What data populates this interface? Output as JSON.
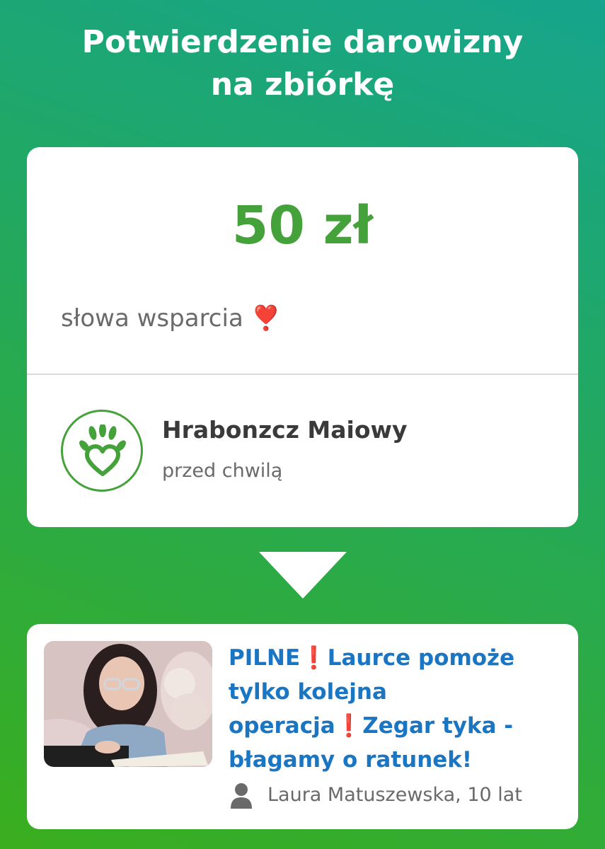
{
  "page": {
    "title_line1": "Potwierdzenie darowizny",
    "title_line2": "na zbiórkę"
  },
  "donation": {
    "amount": "50 zł",
    "message": "słowa wsparcia",
    "message_emoji": "❣️",
    "donor_name": "Hrabonzcz Maiowy",
    "time": "przed chwilą",
    "avatar_icon": "hand-heart-icon",
    "accent_color": "#45a23a"
  },
  "fundraiser": {
    "title_part1": "PILNE",
    "exclamation": "❗",
    "title_part2": "Laurce pomoże tylko kolejna operacja",
    "title_part3": "Zegar tyka - błagamy o ratunek!",
    "beneficiary": "Laura Matuszewska, 10 lat",
    "person_icon": "person-icon",
    "title_color": "#1a76c3"
  }
}
